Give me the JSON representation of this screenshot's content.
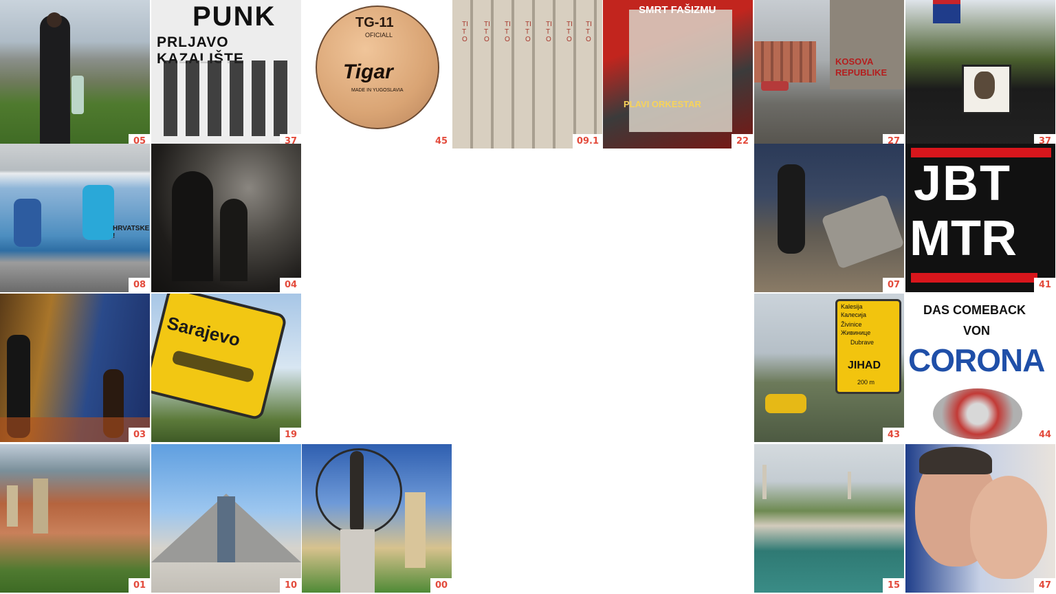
{
  "colors": {
    "accent": "#e34b3c",
    "background": "#ffffff"
  },
  "tiles": [
    {
      "number": "05",
      "subject": "man overlooking city"
    },
    {
      "number": "37",
      "subject": "punk band poster",
      "texts": [
        "PUNK",
        "PRLJAVO KAZALIŠTE"
      ]
    },
    {
      "number": "45",
      "subject": "basketball",
      "texts": [
        "TG-11",
        "OFICIALL",
        "Tigar",
        "MADE IN YUGOSLAVIA"
      ]
    },
    {
      "number": "09.1",
      "subject": "book spines",
      "texts": [
        "TITO"
      ]
    },
    {
      "number": "22",
      "subject": "record sleeve",
      "texts": [
        "SMRT FAŠIZMU",
        "PLAVI ORKESTAR"
      ]
    },
    {
      "number": "27",
      "subject": "street graffiti",
      "texts": [
        "KOSOVA",
        "REPUBLIKE"
      ]
    },
    {
      "number": "37",
      "subject": "march with portrait"
    },
    {
      "number": "08",
      "subject": "wall mural",
      "texts": [
        "HRVATSKE !"
      ]
    },
    {
      "number": "04",
      "subject": "silhouettes in smoke"
    },
    {
      "number": "07",
      "subject": "night street protest"
    },
    {
      "number": "41",
      "subject": "text banner",
      "texts": [
        "JBT",
        "MTR"
      ]
    },
    {
      "number": "03",
      "subject": "street scene at night"
    },
    {
      "number": "19",
      "subject": "city sign",
      "texts": [
        "Sarajevo"
      ]
    },
    {
      "number": "43",
      "subject": "road sign",
      "texts": [
        "Kalesija",
        "Калесија",
        "Živinice",
        "Живинице",
        "Dubrave",
        "JIHAD",
        "200 m"
      ]
    },
    {
      "number": "44",
      "subject": "corona poster",
      "texts": [
        "DAS COMEBACK",
        "VON",
        "CORONA"
      ]
    },
    {
      "number": "01",
      "subject": "old town rooftops"
    },
    {
      "number": "10",
      "subject": "pyramid building"
    },
    {
      "number": "00",
      "subject": "monument sculpture"
    },
    {
      "number": "15",
      "subject": "river town"
    },
    {
      "number": "47",
      "subject": "two faces"
    }
  ]
}
